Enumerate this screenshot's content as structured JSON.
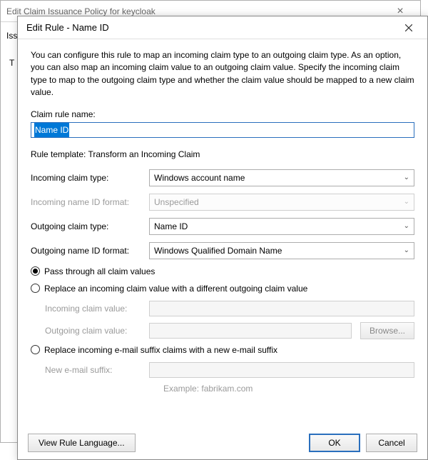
{
  "bg_window": {
    "title": "Edit Claim Issuance Policy for keycloak",
    "left_label_fragment": "Iss",
    "left_inset_char": "T"
  },
  "modal": {
    "title": "Edit Rule - Name ID",
    "intro": "You can configure this rule to map an incoming claim type to an outgoing claim type. As an option, you can also map an incoming claim value to an outgoing claim value. Specify the incoming claim type to map to the outgoing claim type and whether the claim value should be mapped to a new claim value.",
    "claim_rule_name_label": "Claim rule name:",
    "claim_rule_name_value": "Name ID",
    "rule_template_line": "Rule template: Transform an Incoming Claim",
    "rows": {
      "incoming_type_label": "Incoming claim type:",
      "incoming_type_value": "Windows account name",
      "incoming_nameid_label": "Incoming name ID format:",
      "incoming_nameid_value": "Unspecified",
      "outgoing_type_label": "Outgoing claim type:",
      "outgoing_type_value": "Name ID",
      "outgoing_nameid_label": "Outgoing name ID format:",
      "outgoing_nameid_value": "Windows Qualified Domain Name"
    },
    "radios": {
      "pass_through": "Pass through all claim values",
      "replace_value": "Replace an incoming claim value with a different outgoing claim value",
      "replace_suffix": "Replace incoming e-mail suffix claims with a new e-mail suffix"
    },
    "subfields": {
      "incoming_claim_value_label": "Incoming claim value:",
      "outgoing_claim_value_label": "Outgoing claim value:",
      "browse_label": "Browse...",
      "new_email_suffix_label": "New e-mail suffix:",
      "example_text": "Example: fabrikam.com"
    },
    "buttons": {
      "view_rule_language": "View Rule Language...",
      "ok": "OK",
      "cancel": "Cancel"
    }
  }
}
